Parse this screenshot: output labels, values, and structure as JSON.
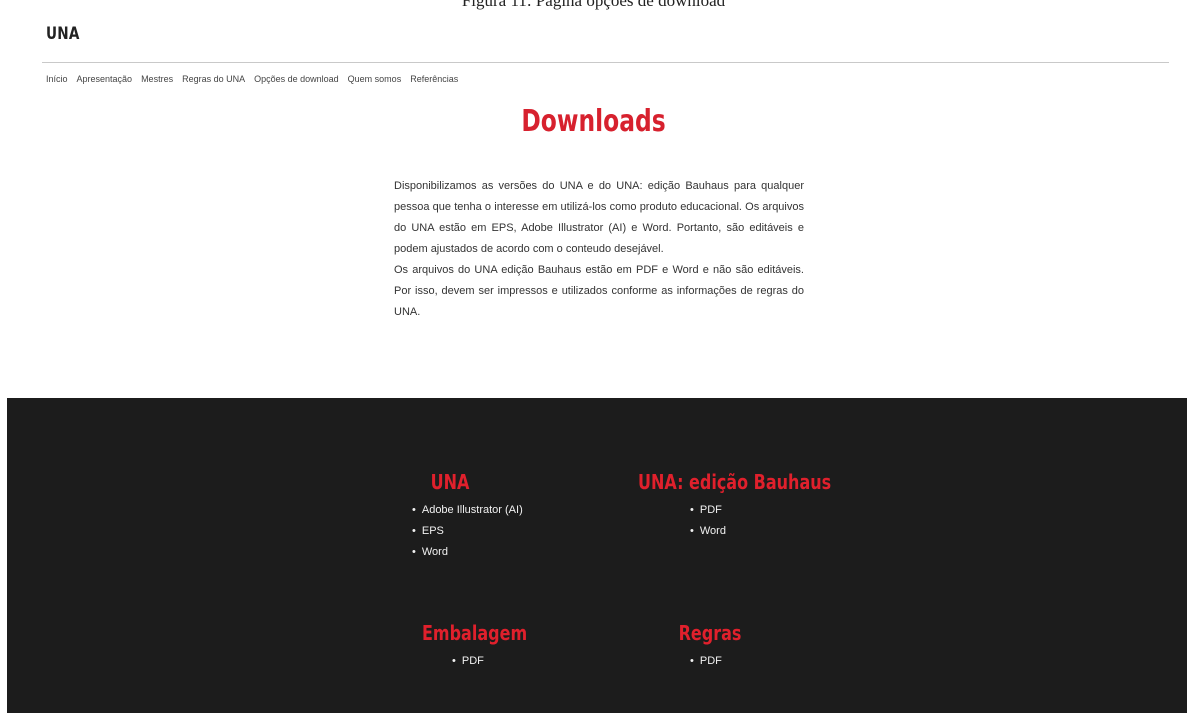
{
  "brand": "UNA",
  "nav": [
    "Início",
    "Apresentação",
    "Mestres",
    "Regras do UNA",
    "Opções de download",
    "Quem somos",
    "Referências"
  ],
  "page_title": "Downloads",
  "intro": [
    "Disponibilizamos as versões do UNA e do UNA: edição Bauhaus para qualquer pessoa que tenha o interesse em utilizá-los como produto educacional. Os arquivos do UNA estão em EPS, Adobe Illustrator (AI) e Word. Portanto, são editáveis e podem ajustados de acordo com o conteudo desejável.",
    "Os arquivos do UNA edição Bauhaus estão em PDF e Word e não são editáveis. Por isso, devem ser impressos e utilizados conforme as informações de regras do UNA."
  ],
  "sections": {
    "una": {
      "title": "UNA",
      "items": [
        "Adobe Illustrator (AI)",
        "EPS",
        "Word"
      ]
    },
    "bauhaus": {
      "title": "UNA: edição Bauhaus",
      "items": [
        "PDF",
        "Word"
      ]
    },
    "embalagem": {
      "title": "Embalagem",
      "items": [
        "PDF"
      ]
    },
    "regras": {
      "title": "Regras",
      "items": [
        "PDF"
      ]
    }
  },
  "colors": {
    "accent": "#d7212e",
    "dark_bg": "#1c1c1c"
  }
}
